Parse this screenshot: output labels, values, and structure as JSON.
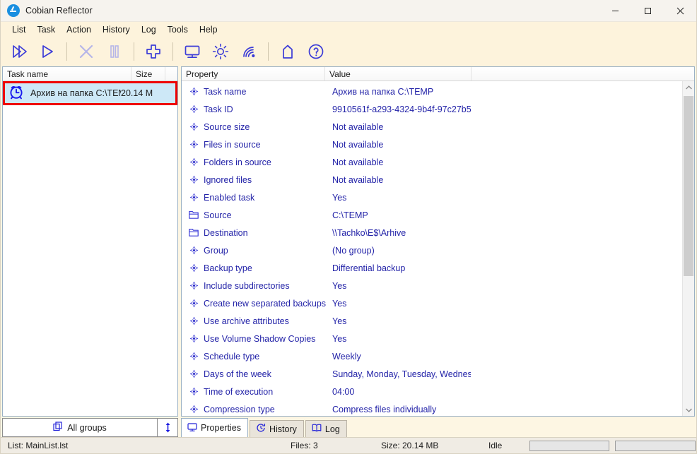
{
  "window": {
    "title": "Cobian Reflector",
    "app_icon": "cobian-logo-icon",
    "minimize_label": "Minimize",
    "maximize_label": "Maximize",
    "close_label": "Close"
  },
  "menu": {
    "items": [
      {
        "label": "List"
      },
      {
        "label": "Task"
      },
      {
        "label": "Action"
      },
      {
        "label": "History"
      },
      {
        "label": "Log"
      },
      {
        "label": "Tools"
      },
      {
        "label": "Help"
      }
    ]
  },
  "toolbar": {
    "buttons": [
      {
        "name": "run-all-tasks-button",
        "icon": "double-play-icon",
        "enabled": true
      },
      {
        "name": "run-selected-task-button",
        "icon": "play-icon",
        "enabled": true
      },
      {
        "name": "stop-button",
        "icon": "stop-x-icon",
        "enabled": false
      },
      {
        "name": "pause-button",
        "icon": "pause-icon",
        "enabled": false
      },
      {
        "name": "new-task-button",
        "icon": "plus-icon",
        "enabled": true
      },
      {
        "name": "view-button",
        "icon": "monitor-icon",
        "enabled": true
      },
      {
        "name": "options-button",
        "icon": "gear-icon",
        "enabled": true
      },
      {
        "name": "remote-connect-button",
        "icon": "wifi-signal-icon",
        "enabled": true
      },
      {
        "name": "home-button",
        "icon": "home-icon",
        "enabled": true
      },
      {
        "name": "help-button",
        "icon": "question-circle-icon",
        "enabled": true
      }
    ]
  },
  "task_list": {
    "columns": [
      {
        "label": "Task name"
      },
      {
        "label": "Size"
      }
    ],
    "rows": [
      {
        "icon": "alarm-clock-icon",
        "name": "Архив на папка C:\\TEM",
        "size": "20.14 M",
        "selected": true,
        "highlighted": true
      }
    ],
    "group_button": {
      "label_pre": "All ",
      "accesskey": "g",
      "label_post": "roups",
      "icon": "copy-stack-icon"
    },
    "sort_button": {
      "icon": "sort-up-down-icon"
    }
  },
  "properties": {
    "columns": [
      {
        "label": "Property"
      },
      {
        "label": "Value"
      }
    ],
    "rows": [
      {
        "icon": "compass-dot-icon",
        "name": "Task name",
        "value": "Архив на папка C:\\TEMP"
      },
      {
        "icon": "compass-dot-icon",
        "name": "Task ID",
        "value": "9910561f-a293-4324-9b4f-97c27b5"
      },
      {
        "icon": "compass-dot-icon",
        "name": "Source size",
        "value": "Not available"
      },
      {
        "icon": "compass-dot-icon",
        "name": "Files in source",
        "value": "Not available"
      },
      {
        "icon": "compass-dot-icon",
        "name": "Folders in source",
        "value": "Not available"
      },
      {
        "icon": "compass-dot-icon",
        "name": "Ignored files",
        "value": "Not available"
      },
      {
        "icon": "compass-dot-icon",
        "name": "Enabled task",
        "value": "Yes"
      },
      {
        "icon": "folder-icon",
        "name": "Source",
        "value": "C:\\TEMP"
      },
      {
        "icon": "folder-icon",
        "name": "Destination",
        "value": "\\\\Tachko\\E$\\Arhive"
      },
      {
        "icon": "compass-dot-icon",
        "name": "Group",
        "value": "(No group)"
      },
      {
        "icon": "compass-dot-icon",
        "name": "Backup type",
        "value": "Differential backup"
      },
      {
        "icon": "compass-dot-icon",
        "name": "Include subdirectories",
        "value": "Yes"
      },
      {
        "icon": "compass-dot-icon",
        "name": "Create new separated backups",
        "value": "Yes"
      },
      {
        "icon": "compass-dot-icon",
        "name": "Use archive attributes",
        "value": "Yes"
      },
      {
        "icon": "compass-dot-icon",
        "name": "Use Volume Shadow Copies",
        "value": "Yes"
      },
      {
        "icon": "compass-dot-icon",
        "name": "Schedule type",
        "value": "Weekly"
      },
      {
        "icon": "compass-dot-icon",
        "name": "Days of the week",
        "value": "Sunday, Monday, Tuesday, Wednes"
      },
      {
        "icon": "compass-dot-icon",
        "name": "Time of execution",
        "value": "04:00"
      },
      {
        "icon": "compass-dot-icon",
        "name": "Compression type",
        "value": "Compress files individually"
      }
    ],
    "scrollbar": {
      "up_arrow": "▲",
      "down_arrow": "▼"
    }
  },
  "tabs": [
    {
      "label": "Properties",
      "icon": "monitor-icon",
      "active": true
    },
    {
      "label": "History",
      "icon": "clock-refresh-icon",
      "active": false
    },
    {
      "label": "Log",
      "icon": "book-icon",
      "active": false
    }
  ],
  "statusbar": {
    "list": "List: MainList.lst",
    "files": "Files: 3",
    "size": "Size: 20.14 MB",
    "state": "Idle",
    "progress_primary": 0,
    "progress_secondary": 0
  },
  "colors": {
    "accent_blue": "#2323a8",
    "selection": "#cde8f7",
    "highlight_red": "#ef0000",
    "toolbar_bg": "#fdf3dc",
    "titlebar_bg": "#f6f3ee"
  }
}
